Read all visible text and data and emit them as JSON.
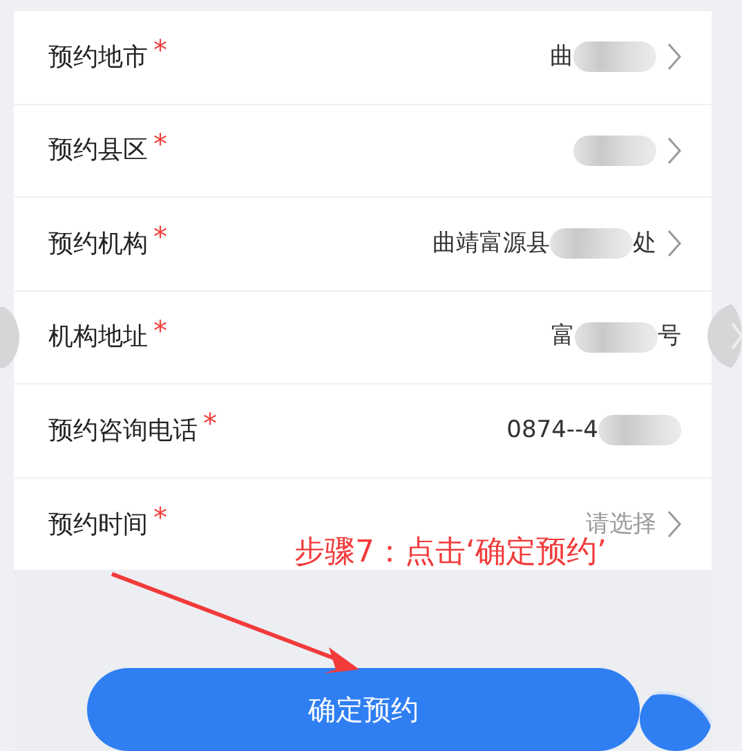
{
  "form": {
    "rows": [
      {
        "label": "预约地市",
        "required_mark": "*",
        "value": [
          {
            "text": "曲"
          },
          {
            "kind": "blur"
          }
        ],
        "chevron": true
      },
      {
        "label": "预约县区",
        "required_mark": "*",
        "value": [
          {
            "kind": "blur"
          }
        ],
        "chevron": true
      },
      {
        "label": "预约机构",
        "required_mark": "*",
        "value": [
          {
            "text": "曲靖富源县"
          },
          {
            "kind": "blur"
          },
          {
            "text": "处"
          }
        ],
        "chevron": true
      },
      {
        "label": "机构地址",
        "required_mark": "*",
        "value": [
          {
            "text": "富"
          },
          {
            "kind": "blur"
          },
          {
            "text": "号"
          }
        ]
      },
      {
        "label": "预约咨询电话",
        "required_mark": "*",
        "value": [
          {
            "text": "0874--4"
          },
          {
            "kind": "blur"
          }
        ]
      },
      {
        "label": "预约时间",
        "required_mark": "*",
        "placeholder": "请选择",
        "chevron": true
      }
    ]
  },
  "annotation": {
    "text": "步骤7：点击‘确定预约’"
  },
  "submit_button": {
    "label": "确定预约"
  }
}
